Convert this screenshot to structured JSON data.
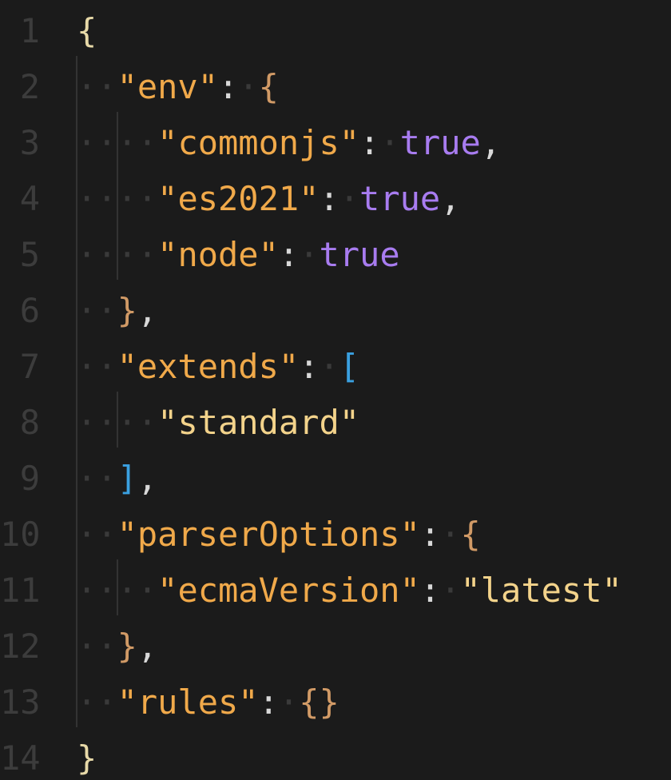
{
  "editor": {
    "lines": [
      {
        "num": "1",
        "tokens": [
          {
            "cls": "b1",
            "text": "{"
          }
        ]
      },
      {
        "num": "2",
        "tokens": [
          {
            "cls": "ws",
            "text": "··"
          },
          {
            "cls": "key",
            "text": "\"env\""
          },
          {
            "cls": "p",
            "text": ":"
          },
          {
            "cls": "ws",
            "text": "·"
          },
          {
            "cls": "b2",
            "text": "{"
          }
        ]
      },
      {
        "num": "3",
        "tokens": [
          {
            "cls": "ws",
            "text": "····"
          },
          {
            "cls": "key",
            "text": "\"commonjs\""
          },
          {
            "cls": "p",
            "text": ":"
          },
          {
            "cls": "ws",
            "text": "·"
          },
          {
            "cls": "bool",
            "text": "true"
          },
          {
            "cls": "p",
            "text": ","
          }
        ]
      },
      {
        "num": "4",
        "tokens": [
          {
            "cls": "ws",
            "text": "····"
          },
          {
            "cls": "key",
            "text": "\"es2021\""
          },
          {
            "cls": "p",
            "text": ":"
          },
          {
            "cls": "ws",
            "text": "·"
          },
          {
            "cls": "bool",
            "text": "true"
          },
          {
            "cls": "p",
            "text": ","
          }
        ]
      },
      {
        "num": "5",
        "tokens": [
          {
            "cls": "ws",
            "text": "····"
          },
          {
            "cls": "key",
            "text": "\"node\""
          },
          {
            "cls": "p",
            "text": ":"
          },
          {
            "cls": "ws",
            "text": "·"
          },
          {
            "cls": "bool",
            "text": "true"
          }
        ]
      },
      {
        "num": "6",
        "tokens": [
          {
            "cls": "ws",
            "text": "··"
          },
          {
            "cls": "b2",
            "text": "}"
          },
          {
            "cls": "p",
            "text": ","
          }
        ]
      },
      {
        "num": "7",
        "tokens": [
          {
            "cls": "ws",
            "text": "··"
          },
          {
            "cls": "key",
            "text": "\"extends\""
          },
          {
            "cls": "p",
            "text": ":"
          },
          {
            "cls": "ws",
            "text": "·"
          },
          {
            "cls": "b3",
            "text": "["
          }
        ]
      },
      {
        "num": "8",
        "tokens": [
          {
            "cls": "ws",
            "text": "····"
          },
          {
            "cls": "str",
            "text": "\"standard\""
          }
        ]
      },
      {
        "num": "9",
        "tokens": [
          {
            "cls": "ws",
            "text": "··"
          },
          {
            "cls": "b3",
            "text": "]"
          },
          {
            "cls": "p",
            "text": ","
          }
        ]
      },
      {
        "num": "10",
        "tokens": [
          {
            "cls": "ws",
            "text": "··"
          },
          {
            "cls": "key",
            "text": "\"parserOptions\""
          },
          {
            "cls": "p",
            "text": ":"
          },
          {
            "cls": "ws",
            "text": "·"
          },
          {
            "cls": "b2",
            "text": "{"
          }
        ]
      },
      {
        "num": "11",
        "tokens": [
          {
            "cls": "ws",
            "text": "····"
          },
          {
            "cls": "key",
            "text": "\"ecmaVersion\""
          },
          {
            "cls": "p",
            "text": ":"
          },
          {
            "cls": "ws",
            "text": "·"
          },
          {
            "cls": "str",
            "text": "\"latest\""
          }
        ]
      },
      {
        "num": "12",
        "tokens": [
          {
            "cls": "ws",
            "text": "··"
          },
          {
            "cls": "b2",
            "text": "}"
          },
          {
            "cls": "p",
            "text": ","
          }
        ]
      },
      {
        "num": "13",
        "tokens": [
          {
            "cls": "ws",
            "text": "··"
          },
          {
            "cls": "key",
            "text": "\"rules\""
          },
          {
            "cls": "p",
            "text": ":"
          },
          {
            "cls": "ws",
            "text": "·"
          },
          {
            "cls": "b2",
            "text": "{}"
          }
        ]
      },
      {
        "num": "14",
        "tokens": [
          {
            "cls": "b1",
            "text": "}"
          }
        ]
      }
    ]
  }
}
